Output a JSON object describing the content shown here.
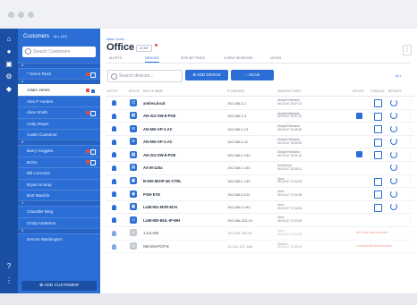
{
  "sidebar": {
    "title": "Customers",
    "filter": "ALL (40)",
    "search_placeholder": "Search Customers",
    "items": [
      {
        "kind": "letter",
        "label": "A"
      },
      {
        "kind": "item",
        "label": "* Demo Rack",
        "badges": true
      },
      {
        "kind": "letter",
        "label": "A"
      },
      {
        "kind": "item",
        "label": "Adam Jones",
        "selected": true,
        "badges": true
      },
      {
        "kind": "item",
        "label": "Alex P Hodem"
      },
      {
        "kind": "item",
        "label": "Alice Smith",
        "badges": true
      },
      {
        "kind": "item",
        "label": "Andy Dwyer"
      },
      {
        "kind": "item",
        "label": "Austin Customer"
      },
      {
        "kind": "letter",
        "label": "B"
      },
      {
        "kind": "item",
        "label": "Barry Goggles",
        "badges": true
      },
      {
        "kind": "item",
        "label": "BC51",
        "badges": true
      },
      {
        "kind": "item",
        "label": "Bill Corcoran"
      },
      {
        "kind": "item",
        "label": "Bryan Scamp"
      },
      {
        "kind": "item",
        "label": "Burt Macklin"
      },
      {
        "kind": "letter",
        "label": "C"
      },
      {
        "kind": "item",
        "label": "Chandler Bing"
      },
      {
        "kind": "item",
        "label": "Cindy Anderson"
      },
      {
        "kind": "letter",
        "label": "D"
      },
      {
        "kind": "item",
        "label": "Denzel Washington"
      }
    ],
    "add_label": "ADD CUSTOMER"
  },
  "main": {
    "breadcrumb": "Adam Jones",
    "title": "Office",
    "tag": "ACME",
    "tabs": [
      "ALERTS",
      "DEVICES",
      "SITE SETTINGS",
      "CLIENT SESSIONS",
      "NOTES"
    ],
    "search_placeholder": "Search devices...",
    "add_device": "ADD DEVICE",
    "scan": "SCAN",
    "filter": "ALL",
    "columns": [
      "NOTIFY",
      "DEVICE",
      "DEVICE NAME",
      "IP ADDRESS",
      "MANUFACTURER",
      "UPDATE",
      "CONSOLE",
      "RESTART"
    ],
    "devices": [
      {
        "name": "andrea.local",
        "ip": "192.168.1.1",
        "mfr": "Ubiquiti Networks",
        "mfr2": "ON 24-07 15:37:14",
        "update": false,
        "console": true,
        "restart": true
      },
      {
        "name": "AN-313-SW-8-POE",
        "ip": "192.168.1.3",
        "mfr": "Ubiquiti Networks",
        "mfr2": "ON 24-07 15:37:14",
        "update": true,
        "console": true,
        "restart": true
      },
      {
        "name": "AN-500-AP-1-AC",
        "ip": "192.168.1.13",
        "mfr": "Ubiquiti Networks",
        "mfr2": "ON 24-07 15:39:28",
        "update": false,
        "console": true,
        "restart": true
      },
      {
        "name": "AN-500-AP-1-AC",
        "ip": "192.168.1.11",
        "mfr": "Ubiquiti Networks",
        "mfr2": "ON 24-07 15:39:29",
        "update": false,
        "console": true,
        "restart": true
      },
      {
        "name": "AN-313-SW-8-POE",
        "ip": "192.168.1.144",
        "mfr": "Ubiquiti Networks",
        "mfr2": "ON 24-07 15:31:24",
        "update": true,
        "console": true,
        "restart": true
      },
      {
        "name": "AX-M-120a",
        "ip": "192.168.1.143",
        "mfr": "Asix/Sonos",
        "mfr2": "ON 24-07 15:39:21",
        "update": false,
        "console": false,
        "restart": true
      },
      {
        "name": "B-900-MOIP-4K-CTRL",
        "ip": "192.168.1.132",
        "mfr": "Linux",
        "mfr2": "ON 24-07 17:04:33",
        "update": false,
        "console": true,
        "restart": true
      },
      {
        "name": "FISH EYE",
        "ip": "192.168.0.211",
        "mfr": "Linux",
        "mfr2": "ON 24-07 17:04:38",
        "update": false,
        "console": true,
        "restart": true
      },
      {
        "name": "LUM-501-MVR-8CH",
        "ip": "192.168.1.142",
        "mfr": "Linux",
        "mfr2": "ON 24-07 17:04:33",
        "update": false,
        "console": true,
        "restart": true
      },
      {
        "name": "LUM-500-BUL-IP-WH",
        "ip": "192.168.224.15",
        "mfr": "Linux",
        "mfr2": "ON 24-07 17:04:33",
        "update": false,
        "console": false,
        "restart": false
      },
      {
        "name": "1.0.0.040",
        "ip": "192.168.254.61",
        "mfr": "Linux",
        "mfr2": "ON 24-07 17:04:33",
        "dim": true,
        "alarm": "All Probe disconnected"
      },
      {
        "name": "NM-200-PCP-8",
        "ip": "10.132.137.188",
        "mfr": "WattBox",
        "mfr2": "ON 24-07 15:39:28",
        "dim": true,
        "alarm": "Connectivity disconnected"
      }
    ]
  },
  "colors": {
    "accent": "#2b6fd6",
    "rail": "#1a4fa3",
    "alarm": "#e74c3c"
  }
}
